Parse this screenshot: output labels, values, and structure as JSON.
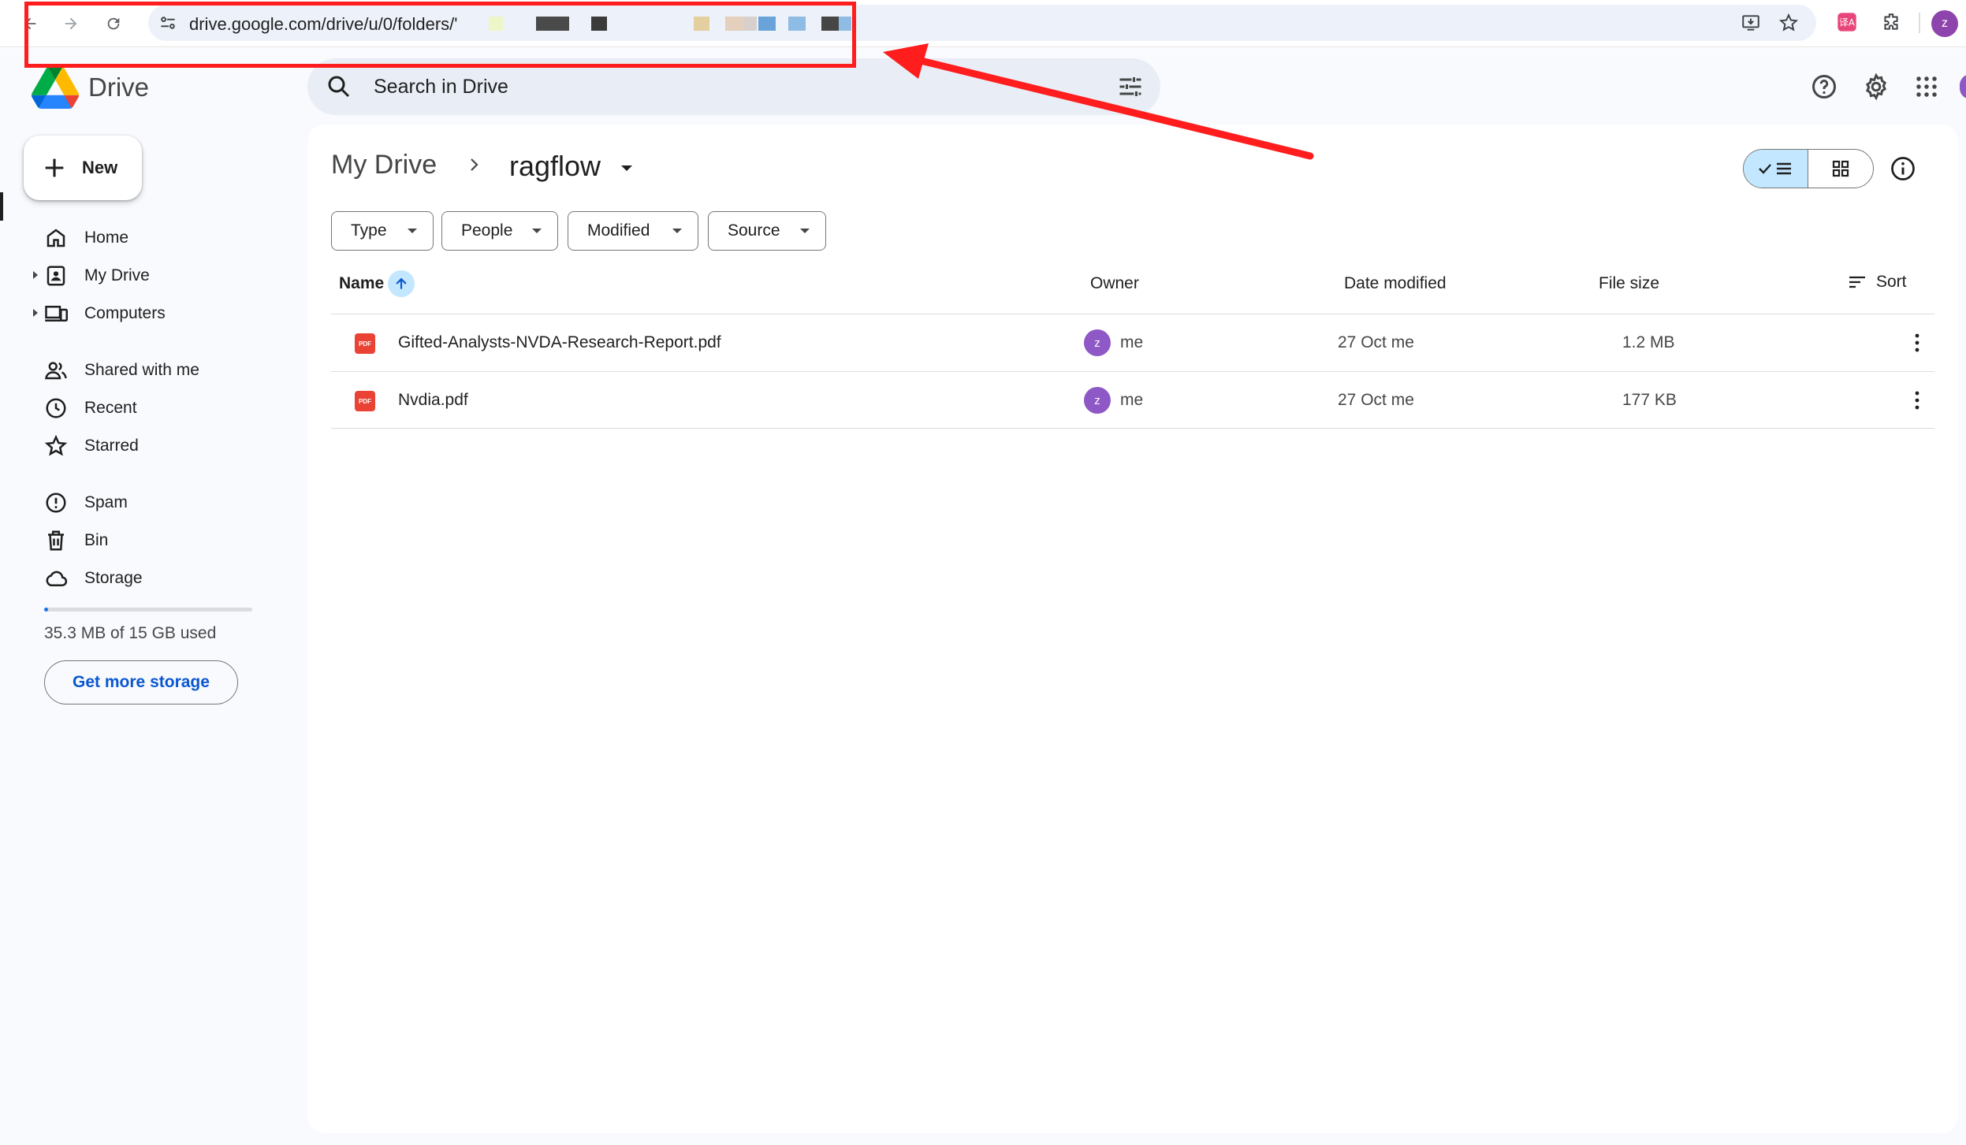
{
  "browser": {
    "url": "drive.google.com/drive/u/0/folders/'",
    "profile_initial": "z"
  },
  "app": {
    "product_name": "Drive"
  },
  "search": {
    "placeholder": "Search in Drive"
  },
  "sidebar": {
    "new_label": "New",
    "items": [
      {
        "label": "Home",
        "icon": "home-icon"
      },
      {
        "label": "My Drive",
        "icon": "my-drive-icon"
      },
      {
        "label": "Computers",
        "icon": "computer-icon"
      },
      {
        "label": "Shared with me",
        "icon": "people-icon"
      },
      {
        "label": "Recent",
        "icon": "clock-icon"
      },
      {
        "label": "Starred",
        "icon": "star-icon"
      },
      {
        "label": "Spam",
        "icon": "spam-icon"
      },
      {
        "label": "Bin",
        "icon": "trash-icon"
      },
      {
        "label": "Storage",
        "icon": "cloud-icon"
      }
    ],
    "storage_text": "35.3 MB of 15 GB used",
    "storage_used_fraction": 0.0024,
    "get_more_storage": "Get more storage"
  },
  "breadcrumb": {
    "root": "My Drive",
    "current": "ragflow"
  },
  "filters": [
    "Type",
    "People",
    "Modified",
    "Source"
  ],
  "table": {
    "columns": {
      "name": "Name",
      "owner": "Owner",
      "date_modified": "Date modified",
      "file_size": "File size",
      "sort": "Sort"
    },
    "rows": [
      {
        "icon_text": "PDF",
        "name": "Gifted-Analysts-NVDA-Research-Report.pdf",
        "owner_initial": "z",
        "owner": "me",
        "modified": "27 Oct me",
        "size": "1.2 MB"
      },
      {
        "icon_text": "PDF",
        "name": "Nvdia.pdf",
        "owner_initial": "z",
        "owner": "me",
        "modified": "27 Oct me",
        "size": "177 KB"
      }
    ]
  },
  "colors": {
    "accent_blue": "#0b57d0",
    "selected_chip": "#c2e7ff",
    "pdf_red": "#ea4335",
    "annotation_red": "#ff1d1d"
  }
}
